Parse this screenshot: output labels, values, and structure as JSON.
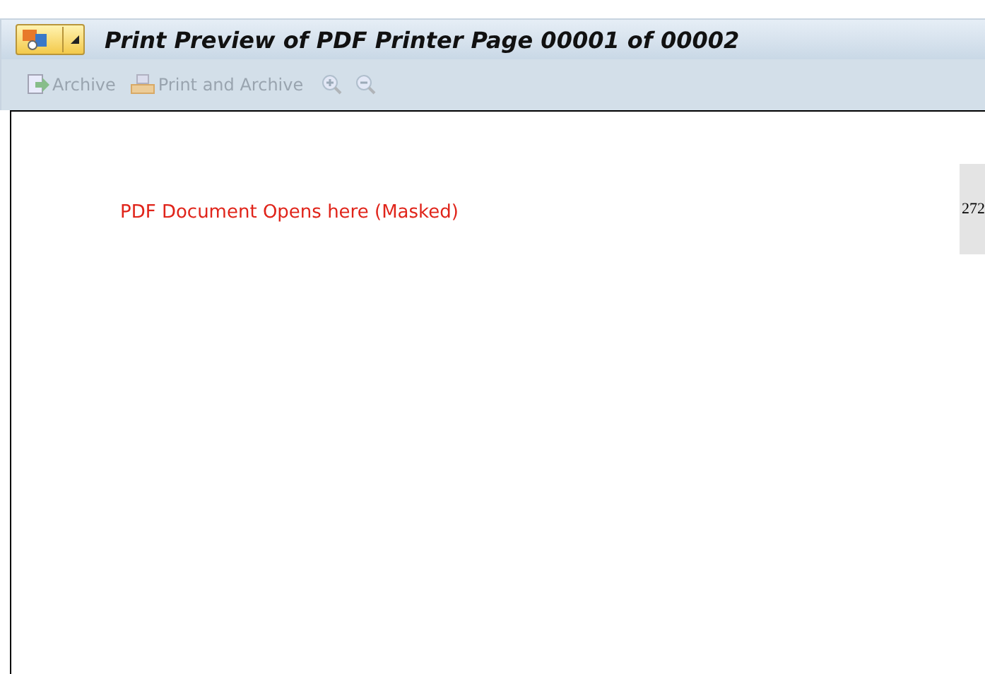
{
  "window": {
    "title": "Print Preview of PDF Printer Page 00001 of 00002"
  },
  "toolbar": [
    {
      "label": "Archive",
      "kind": "archive",
      "disabled": true
    },
    {
      "label": "Print and Archive",
      "kind": "print",
      "disabled": true
    },
    {
      "kind": "zoom-in",
      "disabled": true
    },
    {
      "kind": "zoom-out",
      "disabled": true
    }
  ],
  "document": {
    "message": "PDF Document Opens here (Masked)",
    "side_tab": "272"
  }
}
